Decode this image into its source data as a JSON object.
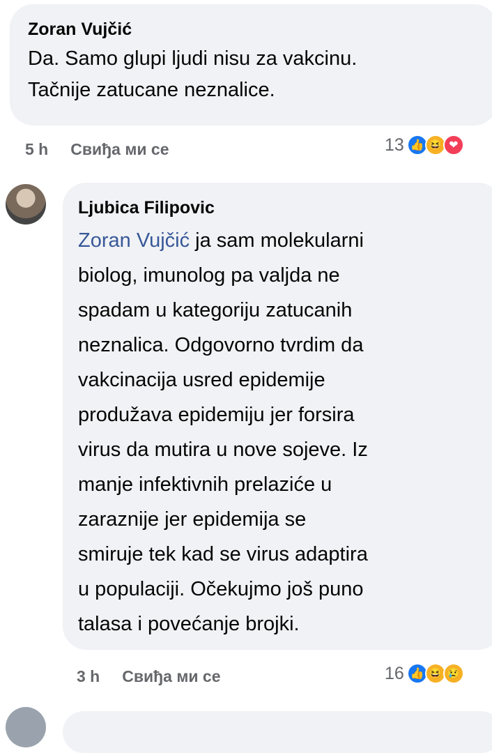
{
  "comments": [
    {
      "author": "Zoran Vujčić",
      "lines": [
        "Da. Samo glupi ljudi nisu za vakcinu.",
        "Tačnije zatucane neznalice."
      ],
      "time": "5 h",
      "like_label": "Свиђа ми се",
      "reaction_count": "13",
      "reactions": [
        "like-icon",
        "haha-icon",
        "love-icon"
      ]
    },
    {
      "author": "Ljubica Filipovic",
      "mention": "Zoran Vujčić",
      "first_line_rest": " ja sam molekularni",
      "lines": [
        "biolog, imunolog pa valjda ne",
        "spadam u kategoriju zatucanih",
        "neznalica. Odgovorno tvrdim da",
        "vakcinacija usred epidemije",
        "produžava epidemiju jer forsira",
        "virus da mutira u nove sojeve. Iz",
        "manje infektivnih prelaziće u",
        "zaraznije jer epidemija se",
        "smiruje tek kad se virus adaptira",
        "u populaciji. Očekujmo još puno",
        "talasa i povećanje brojki."
      ],
      "time": "3 h",
      "like_label": "Свиђа ми се",
      "reaction_count": "16",
      "reactions": [
        "like-icon",
        "haha-icon",
        "sad-icon"
      ]
    }
  ],
  "colors": {
    "bubble": "#f0f2f5",
    "mention": "#385898",
    "meta": "#65676b",
    "like": "#1877f2",
    "haha": "#f7b125",
    "love": "#f33e58"
  }
}
